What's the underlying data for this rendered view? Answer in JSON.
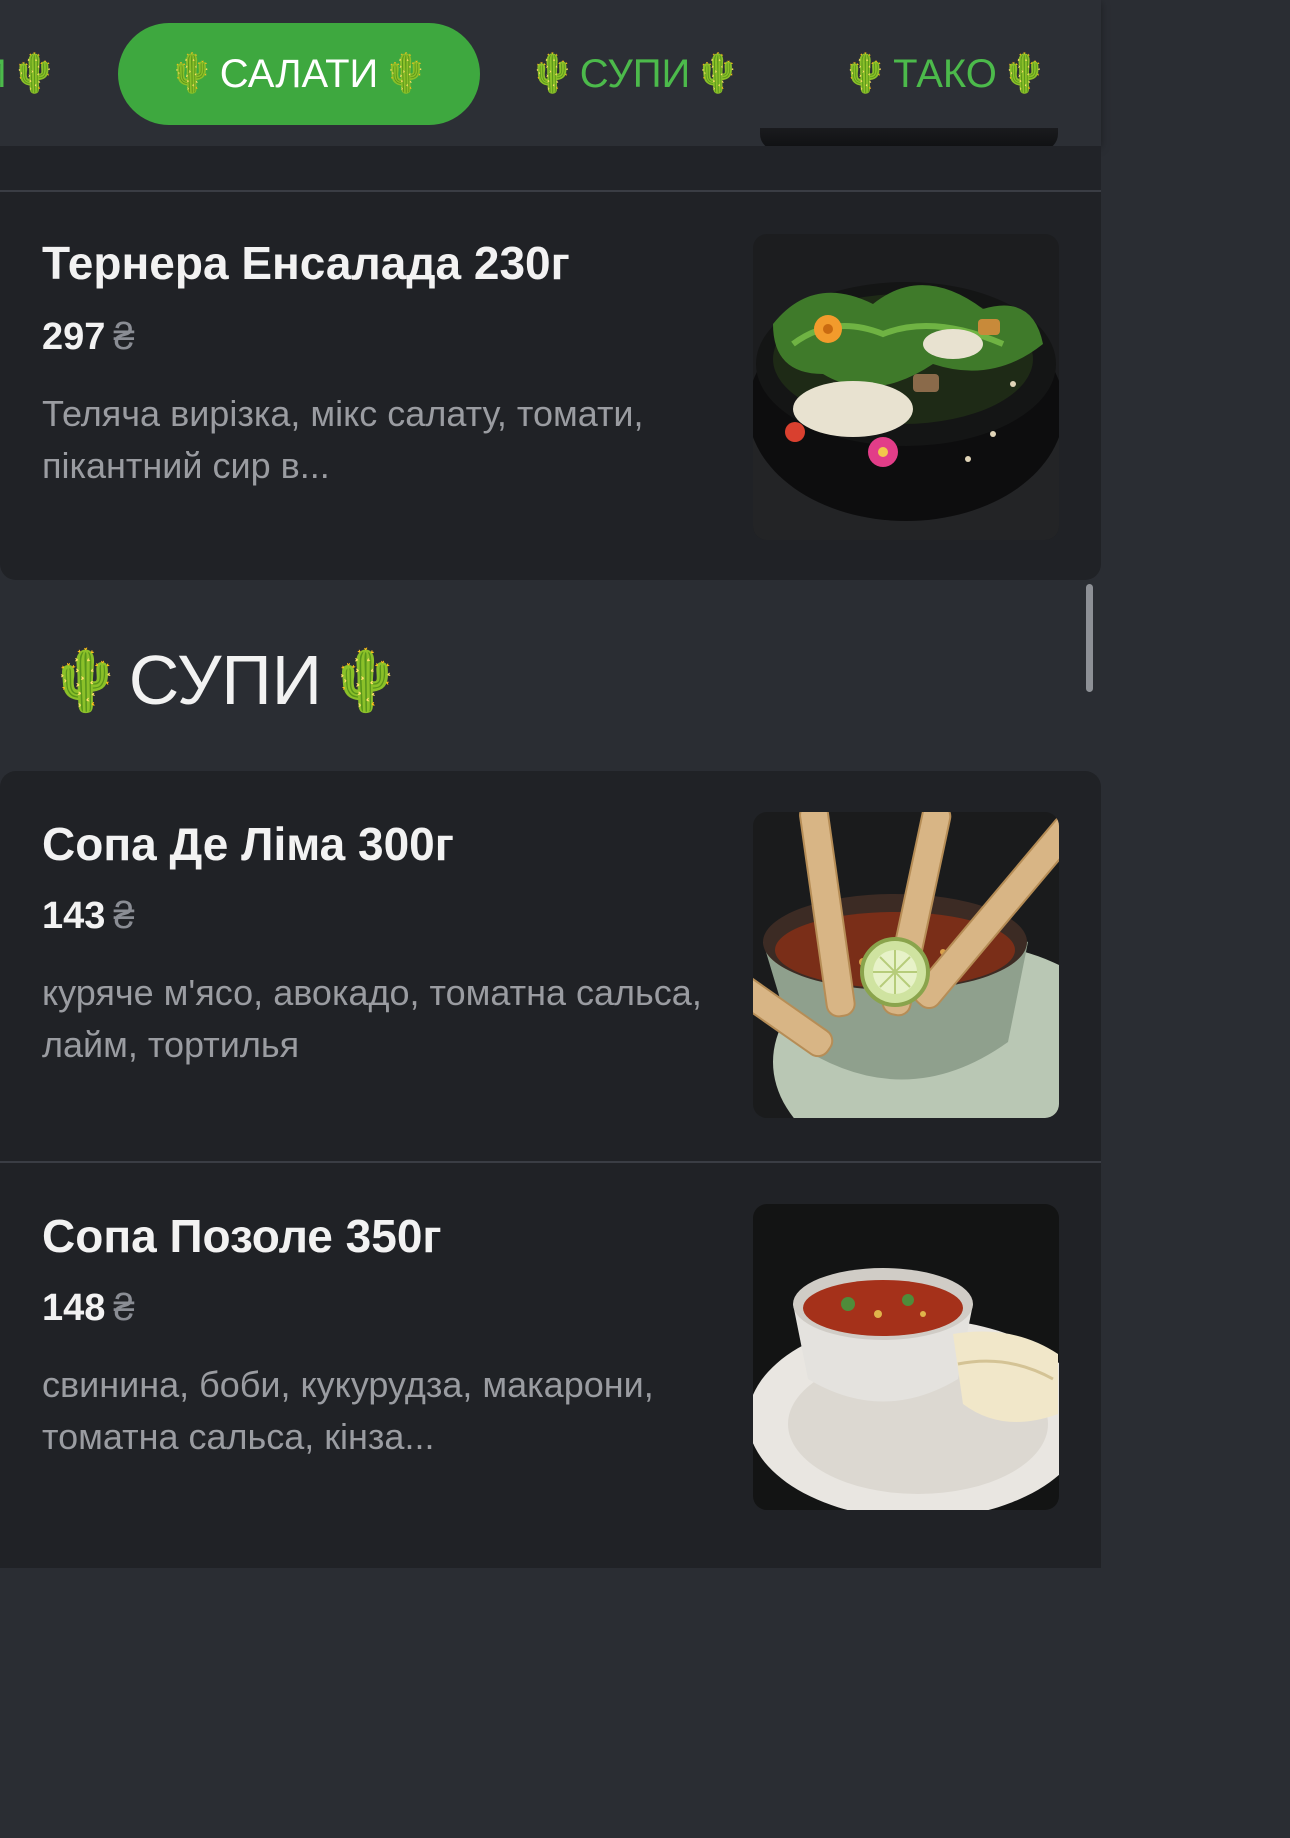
{
  "tabs": [
    {
      "label": "И",
      "icon": "cactus-icon",
      "cactus": "🌵"
    },
    {
      "label": "САЛАТИ",
      "icon": "cactus-icon",
      "cactus": "🌵",
      "active": true
    },
    {
      "label": "СУПИ",
      "icon": "cactus-icon",
      "cactus": "🌵"
    },
    {
      "label": "ТАКО",
      "icon": "cactus-icon",
      "cactus": "🌵"
    }
  ],
  "items": [
    {
      "title": "Тернера Енсалада 230г",
      "price": "297",
      "currency": "₴",
      "description": "Теляча вирізка, мікс салату, томати, пікантний сир в..."
    }
  ],
  "sections": [
    {
      "title": "СУПИ",
      "cactus": "🌵",
      "items": [
        {
          "title": "Сопа Де Ліма 300г",
          "price": "143",
          "currency": "₴",
          "description": "куряче м'ясо, авокадо, томатна сальса, лайм, тортилья"
        },
        {
          "title": "Сопа Позоле 350г",
          "price": "148",
          "currency": "₴",
          "description": "свинина, боби, кукурудза, макарони, томатна сальса, кінза..."
        }
      ]
    }
  ],
  "colors": {
    "accent": "#3ea83f",
    "tab_text": "#4cba4b",
    "background": "#2a2d33",
    "card": "#202226"
  }
}
